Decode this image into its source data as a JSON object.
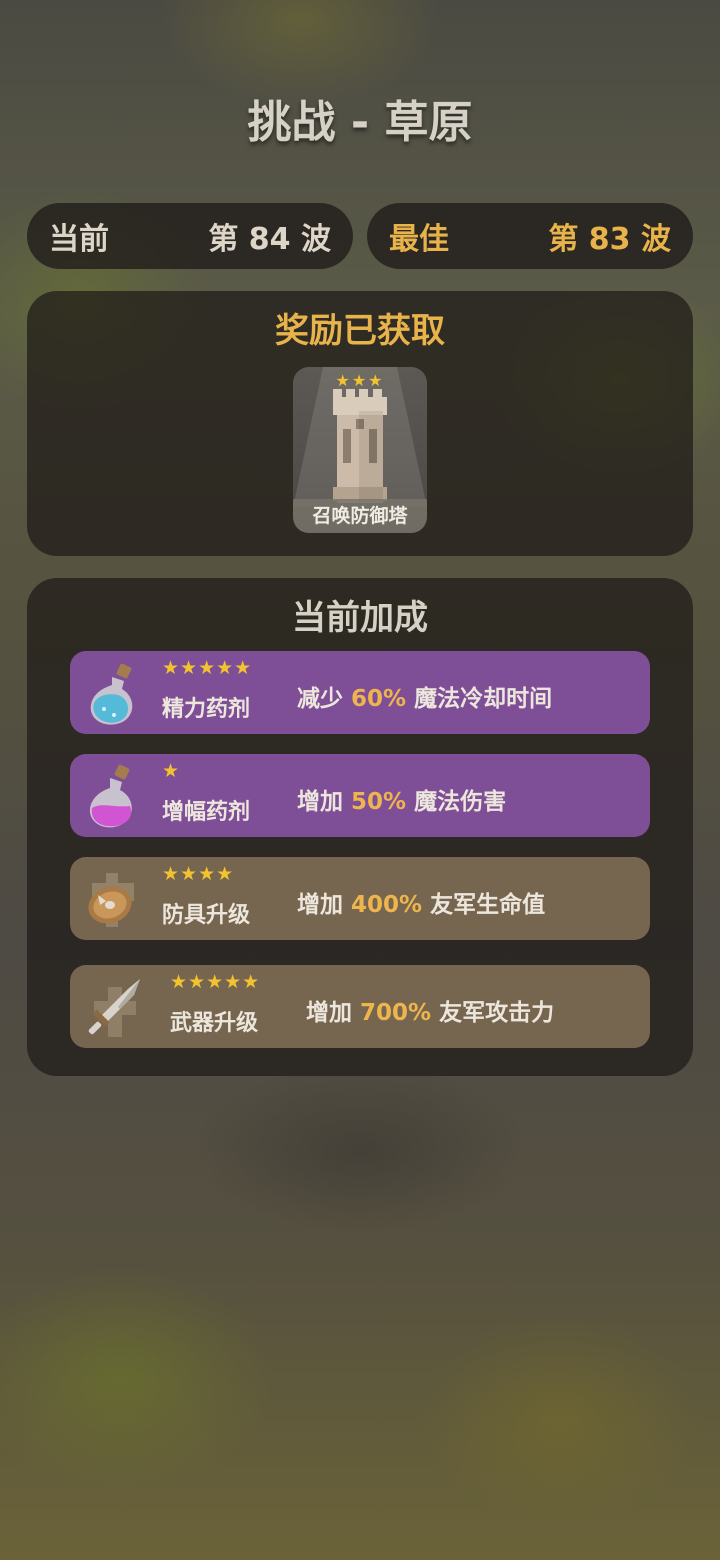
{
  "title": "挑战 - 草原",
  "waves": {
    "current_label": "当前",
    "current_value": "第 84 波",
    "best_label": "最佳",
    "best_value": "第 83 波"
  },
  "rewards": {
    "title": "奖励已获取",
    "item": {
      "name": "召唤防御塔",
      "stars": "★★★",
      "icon": "tower-icon"
    }
  },
  "bonuses": {
    "title": "当前加成",
    "items": [
      {
        "name": "精力药剂",
        "stars": "★★★★★",
        "prefix": "减少",
        "amount": "60%",
        "suffix": "魔法冷却时间",
        "icon": "blue-potion-icon",
        "color": "#7e4f96"
      },
      {
        "name": "增幅药剂",
        "stars": "★",
        "prefix": "增加",
        "amount": "50%",
        "suffix": "魔法伤害",
        "icon": "pink-potion-icon",
        "color": "#7e4f96"
      },
      {
        "name": "防具升级",
        "stars": "★★★★",
        "prefix": "增加",
        "amount": "400%",
        "suffix": "友军生命值",
        "icon": "shield-icon",
        "color": "#76664f"
      },
      {
        "name": "武器升级",
        "stars": "★★★★★",
        "prefix": "增加",
        "amount": "700%",
        "suffix": "友军攻击力",
        "icon": "sword-icon",
        "color": "#76664f"
      }
    ]
  }
}
